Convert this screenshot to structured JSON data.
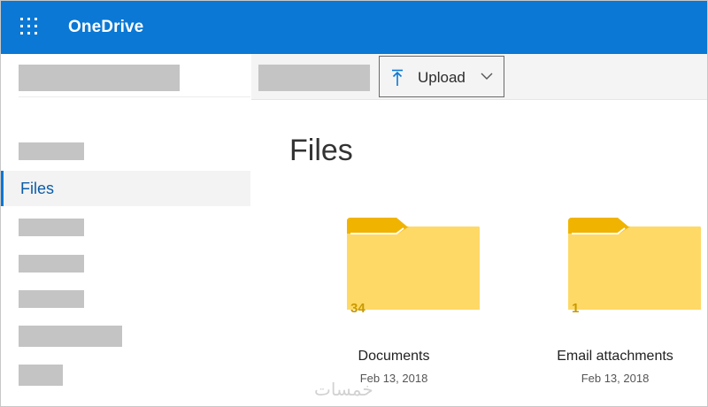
{
  "header": {
    "app_name": "OneDrive",
    "background_color": "#0a78d4",
    "waffle_icon": "app-launcher-icon"
  },
  "sidebar": {
    "selected_item": "Files",
    "accent_color": "#0a78d4"
  },
  "command_bar": {
    "upload_label": "Upload",
    "upload_icon": "upload-arrow-icon",
    "dropdown_icon": "chevron-down-icon"
  },
  "main": {
    "title": "Files",
    "folders": [
      {
        "name": "Documents",
        "date": "Feb 13, 2018",
        "count": "34",
        "color": "#ffd966"
      },
      {
        "name": "Email attachments",
        "date": "Feb 13, 2018",
        "count": "1",
        "color": "#ffd966"
      }
    ]
  },
  "watermark": {
    "text": "خمسات"
  }
}
